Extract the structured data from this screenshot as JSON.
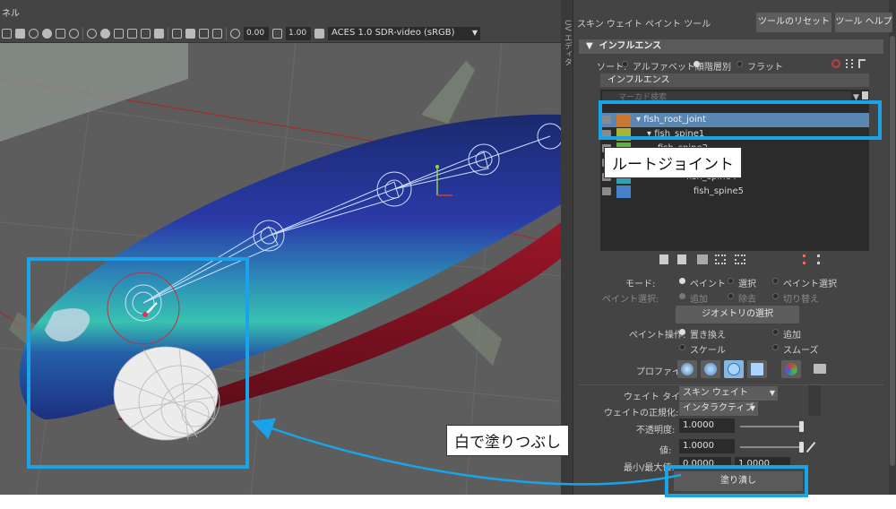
{
  "viewport": {
    "panel_title_fragment": "ネル",
    "field_a": "0.00",
    "field_b": "1.00",
    "color_space": "ACES 1.0 SDR-video (sRGB)"
  },
  "panel": {
    "uv_tab": "UV エディタ",
    "tool_title": "スキン ウェイト ペイント ツール",
    "reset_button": "ツールのリセット",
    "help_button": "ツール ヘルプ",
    "section_title": "インフルエンス",
    "sort_label": "ソート:",
    "sort_options": [
      "アルファベット順",
      "階層別",
      "フラット"
    ],
    "sort_selected": 1,
    "influence_header": "インフルエンス",
    "search_placeholder": "マーカド検索",
    "joints": [
      {
        "name": "fish_root_joint",
        "color": "#c87832",
        "selected": true
      },
      {
        "name": "fish_spine1",
        "color": "#a8b432",
        "selected": false
      },
      {
        "name": "fish_spine2",
        "color": "#5cb43c",
        "selected": false
      },
      {
        "name": "fish_spine3",
        "color": "#3cb48c",
        "selected": false
      },
      {
        "name": "fish_spine4",
        "color": "#32a0b4",
        "selected": false
      },
      {
        "name": "fish_spine5",
        "color": "#4682c8",
        "selected": false
      }
    ],
    "mode_label": "モード:",
    "mode_options": [
      "ペイント",
      "選択",
      "ペイント選択"
    ],
    "paint_select_label": "ペイント選択:",
    "paint_select_options": [
      "追加",
      "除去",
      "切り替え"
    ],
    "geometry_select_button": "ジオメトリの選択",
    "paint_op_label": "ペイント操作:",
    "paint_op_options": [
      "置き換え",
      "追加",
      "スケール",
      "スムーズ"
    ],
    "profile_label": "プロファイル:",
    "weight_type_label": "ウェイト タイプ:",
    "weight_type_value": "スキン ウェイト",
    "normalize_label": "ウェイトの正規化:",
    "normalize_value": "インタラクティブ",
    "opacity_label": "不透明度:",
    "opacity_value": "1.0000",
    "opacity_level": 1.0,
    "value_label": "値:",
    "value_value": "1.0000",
    "value_level": 1.0,
    "minmax_label": "最小/最大値:",
    "min_value": "0.0000",
    "max_value": "1.0000",
    "flood_button": "塗り潰し"
  },
  "annotations": {
    "root_joint_callout": "ルートジョイント",
    "flood_white_callout": "白で塗りつぶし",
    "highlight_color": "#1aa3e8"
  }
}
